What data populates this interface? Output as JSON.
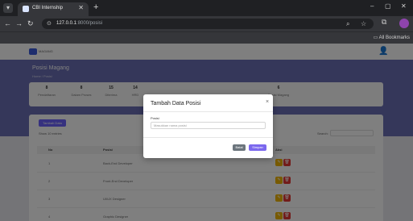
{
  "browser": {
    "tab_title": "CBI Internship",
    "url_host": "127.0.0.1",
    "url_path": ":8000/posisi",
    "all_bookmarks": "All Bookmarks",
    "new_tab_glyph": "+",
    "back_glyph": "←",
    "forward_glyph": "→",
    "reload_glyph": "↻",
    "site_info_glyph": "⊙",
    "zoom_glyph": "⌕",
    "bookmark_glyph": "☆",
    "extensions_glyph": "⧉",
    "bookmarks_folder_glyph": "▭",
    "minimize_glyph": "–",
    "maximize_glyph": "▢",
    "close_glyph": "✕"
  },
  "navbar": {
    "logo_text": "MAGANG",
    "user_glyph": "👤"
  },
  "hero": {
    "title": "Posisi Magang",
    "breadcrumb": "Home / Posisi"
  },
  "stats": [
    {
      "count": "8",
      "label": "Pendaftaran"
    },
    {
      "count": "8",
      "label": "Dalam Proses"
    },
    {
      "count": "15",
      "label": "Diterima"
    },
    {
      "count": "14",
      "label": "HRD"
    },
    {
      "count": "6",
      "label": "Posisi Magang"
    }
  ],
  "table_card": {
    "add_button": "Tambah Data",
    "show_entries": "Show 10 entries",
    "search_label": "Search:",
    "headers": {
      "no": "No",
      "posisi": "Posisi",
      "aksi": "Aksi"
    },
    "rows": [
      {
        "no": "1",
        "name": "Back-End Developer"
      },
      {
        "no": "2",
        "name": "Front-End Developer"
      },
      {
        "no": "3",
        "name": "UI/UX Designer"
      },
      {
        "no": "4",
        "name": "Graphic Designer"
      }
    ],
    "edit_glyph": "✎",
    "delete_glyph": "🗑"
  },
  "modal": {
    "title": "Tambah Data Posisi",
    "close_glyph": "×",
    "field_label": "Posisi",
    "field_placeholder": "Masukkan nama posisi",
    "field_value": "",
    "cancel_label": "Batal",
    "save_label": "Simpan"
  },
  "colors": {
    "hero": "#6b6fb4",
    "primary_button": "#7b68ee",
    "cancel_button": "#6c757d",
    "edit_action": "#f0b400",
    "delete_action": "#e53935",
    "browser_chrome": "#35363a"
  }
}
